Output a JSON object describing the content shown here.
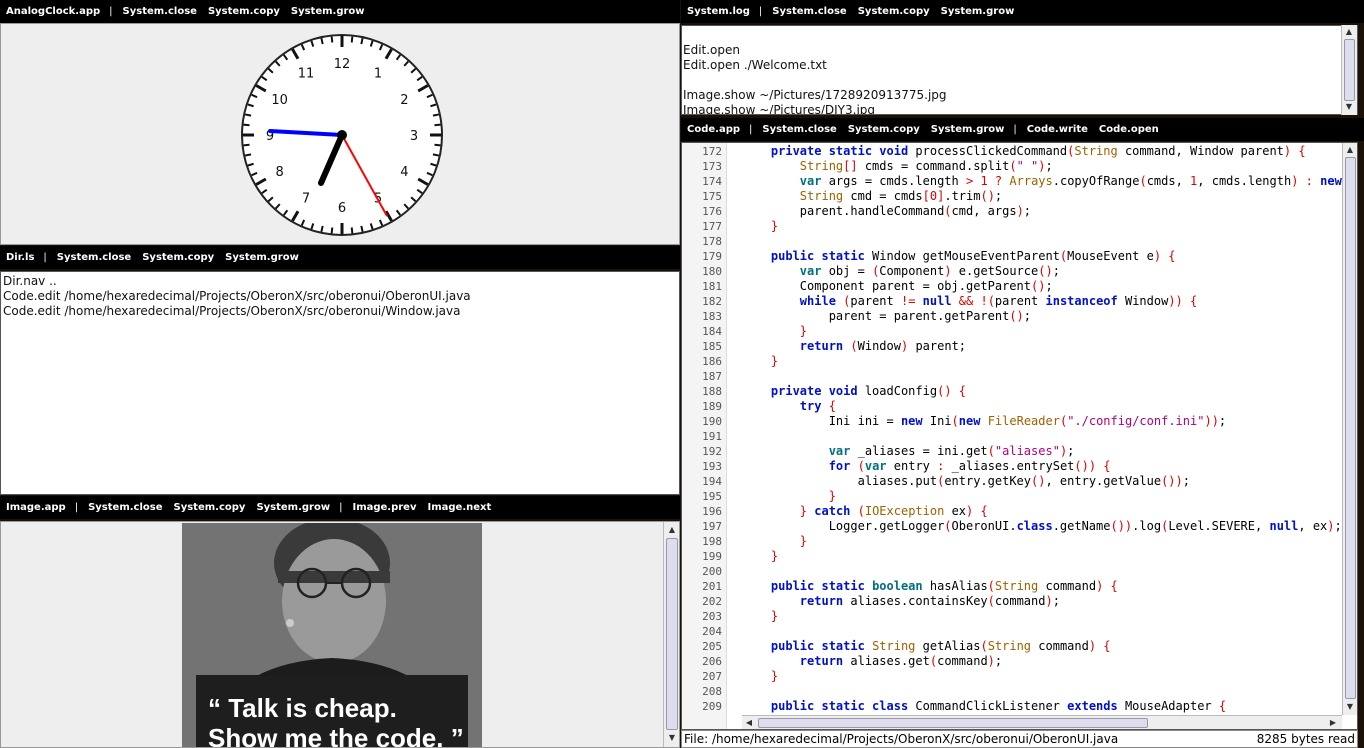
{
  "clock_pane": {
    "title": [
      "AnalogClock.app",
      "System.close",
      "System.copy",
      "System.grow"
    ],
    "numbers": [
      "12",
      "1",
      "2",
      "3",
      "4",
      "5",
      "6",
      "7",
      "8",
      "9",
      "10",
      "11"
    ]
  },
  "dir_pane": {
    "title": [
      "Dir.ls",
      "System.close",
      "System.copy",
      "System.grow"
    ],
    "lines": [
      "Dir.nav ..",
      "Code.edit /home/hexaredecimal/Projects/OberonX/src/oberonui/OberonUI.java",
      "Code.edit /home/hexaredecimal/Projects/OberonX/src/oberonui/Window.java"
    ]
  },
  "image_pane": {
    "title": [
      "Image.app",
      "System.close",
      "System.copy",
      "System.grow",
      "Image.prev",
      "Image.next"
    ],
    "quote_line1": "“ Talk is cheap.",
    "quote_line2": "Show me the code. ”"
  },
  "log_pane": {
    "title": [
      "System.log",
      "System.close",
      "System.copy",
      "System.grow"
    ],
    "lines": [
      "",
      "Edit.open",
      "Edit.open ./Welcome.txt",
      "",
      "Image.show ~/Pictures/1728920913775.jpg",
      "Image.show ~/Pictures/DIY3.jpg"
    ]
  },
  "code_pane": {
    "title": [
      "Code.app",
      "System.close",
      "System.copy",
      "System.grow",
      "Code.write",
      "Code.open"
    ],
    "line_numbers": [
      "172",
      "173",
      "174",
      "175",
      "176",
      "177",
      "178",
      "179",
      "180",
      "181",
      "182",
      "183",
      "184",
      "185",
      "186",
      "187",
      "188",
      "189",
      "190",
      "191",
      "192",
      "193",
      "194",
      "195",
      "196",
      "197",
      "198",
      "199",
      "200",
      "201",
      "202",
      "203",
      "204",
      "205",
      "206",
      "207",
      "208",
      "209"
    ],
    "status_file": "File: /home/hexaredecimal/Projects/OberonX/src/oberonui/OberonUI.java",
    "status_bytes": "8285 bytes read"
  },
  "colors": {
    "keyword": "#0010c8",
    "type": "#a06000",
    "punct": "#d00000",
    "string": "#b00080",
    "minute_hand": "#0000ff",
    "second_hand": "#ff0000"
  }
}
